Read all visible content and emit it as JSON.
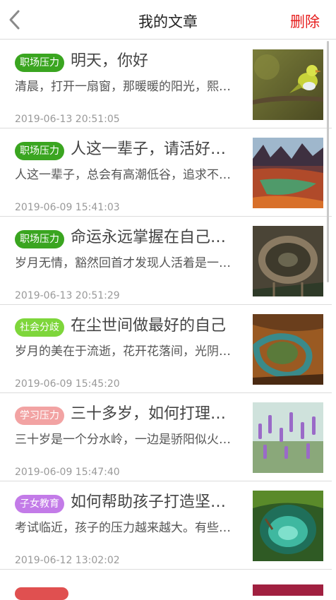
{
  "header": {
    "back_icon": "chevron-left-icon",
    "title": "我的文章",
    "delete_label": "删除",
    "delete_color": "#e62020"
  },
  "articles": [
    {
      "tag": "职场压力",
      "tag_color": "#3aa520",
      "title": "明天，你好",
      "summary": "清晨，打开一扇窗，那暖暖的阳光，熙…",
      "date": "2019-06-13 20:51:05",
      "image": "bird-on-branch"
    },
    {
      "tag": "职场压力",
      "tag_color": "#3aa520",
      "title": "人这一辈子，请活好…",
      "summary": "人这一辈子，总会有高潮低谷，追求不…",
      "date": "2019-06-09 15:41:03",
      "image": "colorful-canyon-river"
    },
    {
      "tag": "职场压力",
      "tag_color": "#3aa520",
      "title": "命运永远掌握在自己…",
      "summary": "岁月无情，豁然回首才发现人活着是一…",
      "date": "2019-06-13 20:51:29",
      "image": "circular-bridge-aerial"
    },
    {
      "tag": "社会分歧",
      "tag_color": "#7ed63b",
      "title": "在尘世间做最好的自己",
      "summary": "岁月的美在于流逝，花开花落间，光阴…",
      "date": "2019-06-09 15:45:20",
      "image": "horseshoe-river-bend"
    },
    {
      "tag": "学习压力",
      "tag_color": "#f2a3a3",
      "title": "三十多岁，如何打理…",
      "summary": "三十岁是一个分水岭，一边是骄阳似火…",
      "date": "2019-06-09 15:47:40",
      "image": "lavender-field"
    },
    {
      "tag": "子女教育",
      "tag_color": "#c37be8",
      "title": "如何帮助孩子打造坚…",
      "summary": "考试临近，孩子的压力越来越大。有些…",
      "date": "2019-06-12 13:02:02",
      "image": "green-cave-pool"
    }
  ],
  "partial_tag_color": "#e05050"
}
